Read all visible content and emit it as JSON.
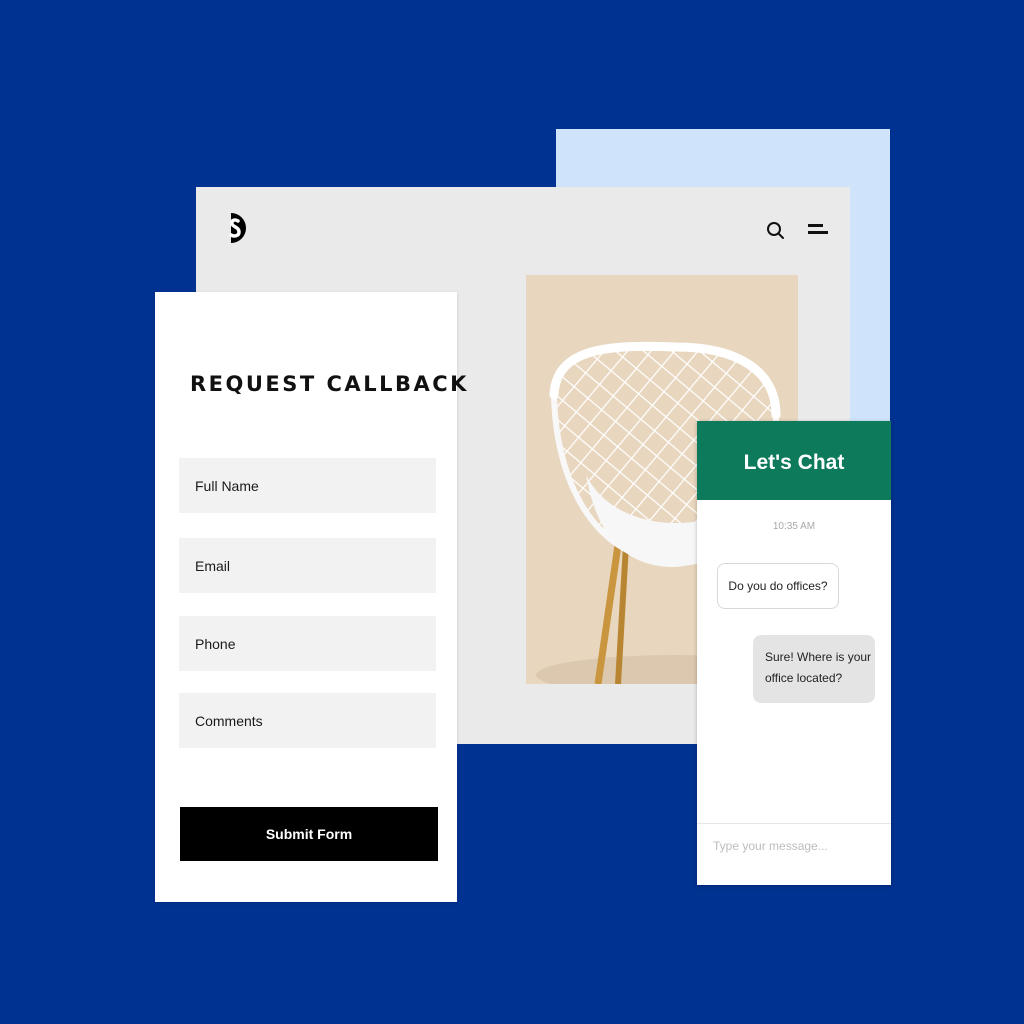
{
  "site": {
    "logo_icon": "brand-s-logo",
    "search_icon": "search-icon",
    "menu_icon": "menu-icon",
    "hero_image": "white-wire-chair-photo"
  },
  "form": {
    "title": "REQUEST CALLBACK",
    "fields": [
      {
        "label": "Full Name"
      },
      {
        "label": "Email"
      },
      {
        "label": "Phone"
      },
      {
        "label": "Comments"
      }
    ],
    "submit_label": "Submit Form"
  },
  "chat": {
    "title": "Let's Chat",
    "timestamp": "10:35 AM",
    "messages": [
      {
        "from": "visitor",
        "text": "Do you do offices?"
      },
      {
        "from": "agent",
        "text": "Sure! Where is your office located?"
      }
    ],
    "input_placeholder": "Type your message..."
  },
  "colors": {
    "background": "#003291",
    "back_panel": "#cfe4fb",
    "site_window": "#eaeaea",
    "chat_header": "#0d7a5c",
    "submit_button": "#000000"
  }
}
